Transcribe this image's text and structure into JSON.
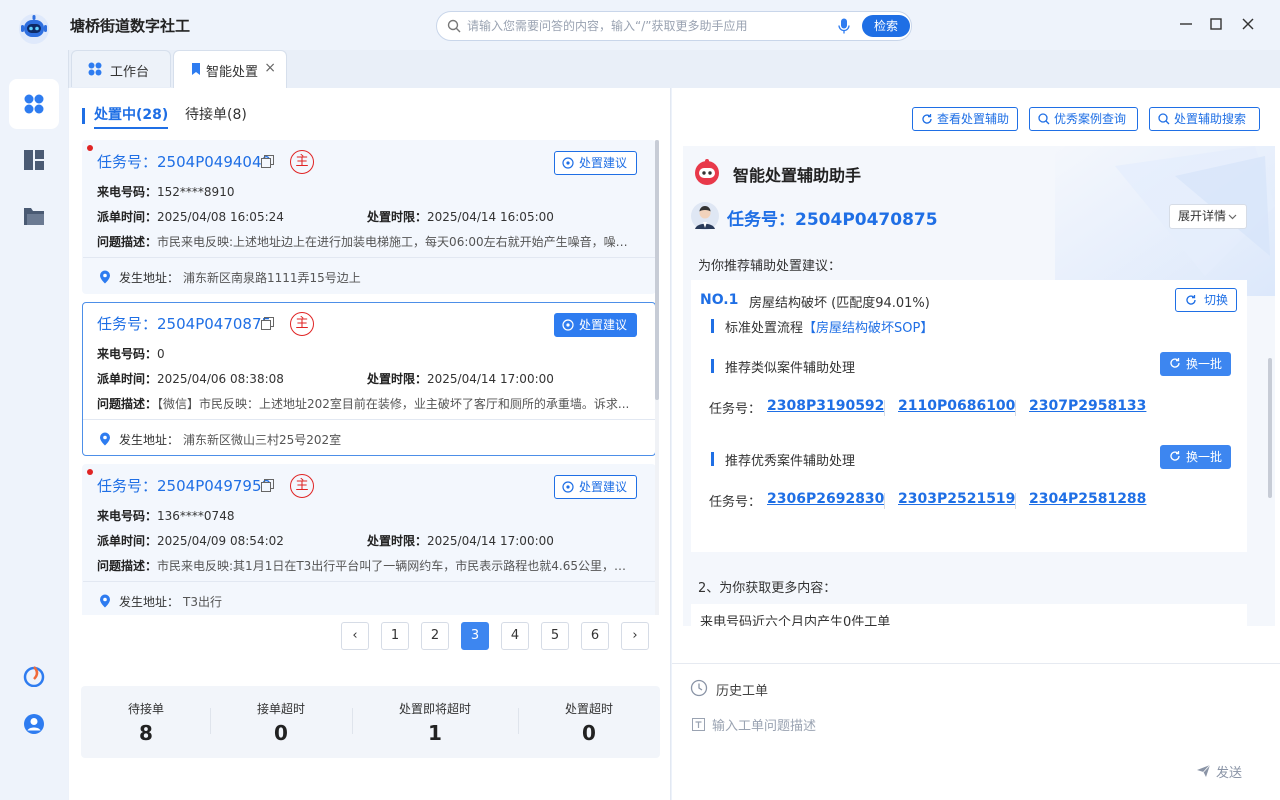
{
  "app": {
    "title": "塘桥街道数字社工"
  },
  "search": {
    "placeholder": "请输入您需要问答的内容，输入“/”获取更多助手应用",
    "button": "检索"
  },
  "tabs": [
    {
      "label": "工作台",
      "icon": "grid-icon"
    },
    {
      "label": "智能处置",
      "icon": "bookmark-icon",
      "close": "×"
    }
  ],
  "subtabs": [
    {
      "label": "处置中(28)"
    },
    {
      "label": "待接单(8)"
    }
  ],
  "labels": {
    "task_prefix": "任务号：",
    "phone": "来电号码：",
    "dispatch": "派单时间：",
    "deadline": "处置时限：",
    "desc": "问题描述：",
    "addr": "发生地址：",
    "zhu": "主",
    "suggest": "处置建议"
  },
  "cards": [
    {
      "task_no": "2504P0494040",
      "phone": "152****8910",
      "dispatch_time": "2025/04/08 16:05:24",
      "deadline": "2025/04/14 16:05:00",
      "desc": "市民来电反映:上述地址边上在进行加装电梯施工，每天06:00左右就开始产生噪音，噪音...",
      "addr": "浦东新区南泉路1111弄15号边上"
    },
    {
      "task_no": "2504P0470875",
      "phone": "0",
      "dispatch_time": "2025/04/06 08:38:08",
      "deadline": "2025/04/14 17:00:00",
      "desc": "【微信】市民反映：上述地址202室目前在装修，业主破坏了客厅和厕所的承重墙。诉求...",
      "addr": "浦东新区微山三村25号202室"
    },
    {
      "task_no": "2504P0497958",
      "phone": "136****0748",
      "dispatch_time": "2025/04/09 08:54:02",
      "deadline": "2025/04/14 17:00:00",
      "desc": "市民来电反映:其1月1日在T3出行平台叫了一辆网约车，市民表示路程也就4.65公里，路...",
      "addr": "T3出行"
    }
  ],
  "pager": {
    "pages": [
      "1",
      "2",
      "3",
      "4",
      "5",
      "6"
    ],
    "current": "3",
    "prev": "‹",
    "next": "›"
  },
  "stats": [
    {
      "label": "待接单",
      "value": "8"
    },
    {
      "label": "接单超时",
      "value": "0"
    },
    {
      "label": "处置即将超时",
      "value": "1"
    },
    {
      "label": "处置超时",
      "value": "0"
    }
  ],
  "right_buttons": [
    {
      "label": "查看处置辅助"
    },
    {
      "label": "优秀案例查询"
    },
    {
      "label": "处置辅助搜索"
    }
  ],
  "assistant": {
    "title": "智能处置辅助助手",
    "task": "任务号：2504P0470875",
    "expand": "展开详情",
    "recommend": "为你推荐辅助处置建议：",
    "no": "NO.1",
    "category": "房屋结构破坏 (匹配度94.01%)",
    "switch": "切换",
    "sop_label": "标准处置流程",
    "sop_link": "【房屋结构破坏SOP】",
    "similar_label": "推荐类似案件辅助处理",
    "excellent_label": "推荐优秀案件辅助处理",
    "refresh": "换一批",
    "task_label": "任务号：",
    "similar_tasks": [
      "2308P3190592",
      "2110P0686100",
      "2307P2958133"
    ],
    "excellent_tasks": [
      "2306P2692830",
      "2303P2521519",
      "2304P2581288"
    ],
    "more_title": "2、为你获取更多内容：",
    "more_text": "来电号码近六个月内产生0件工单"
  },
  "bottom": {
    "history": "历史工单",
    "input_placeholder": "输入工单问题描述",
    "send": "发送"
  },
  "colors": {
    "accent": "#1f6fe5",
    "danger": "#e02424"
  }
}
